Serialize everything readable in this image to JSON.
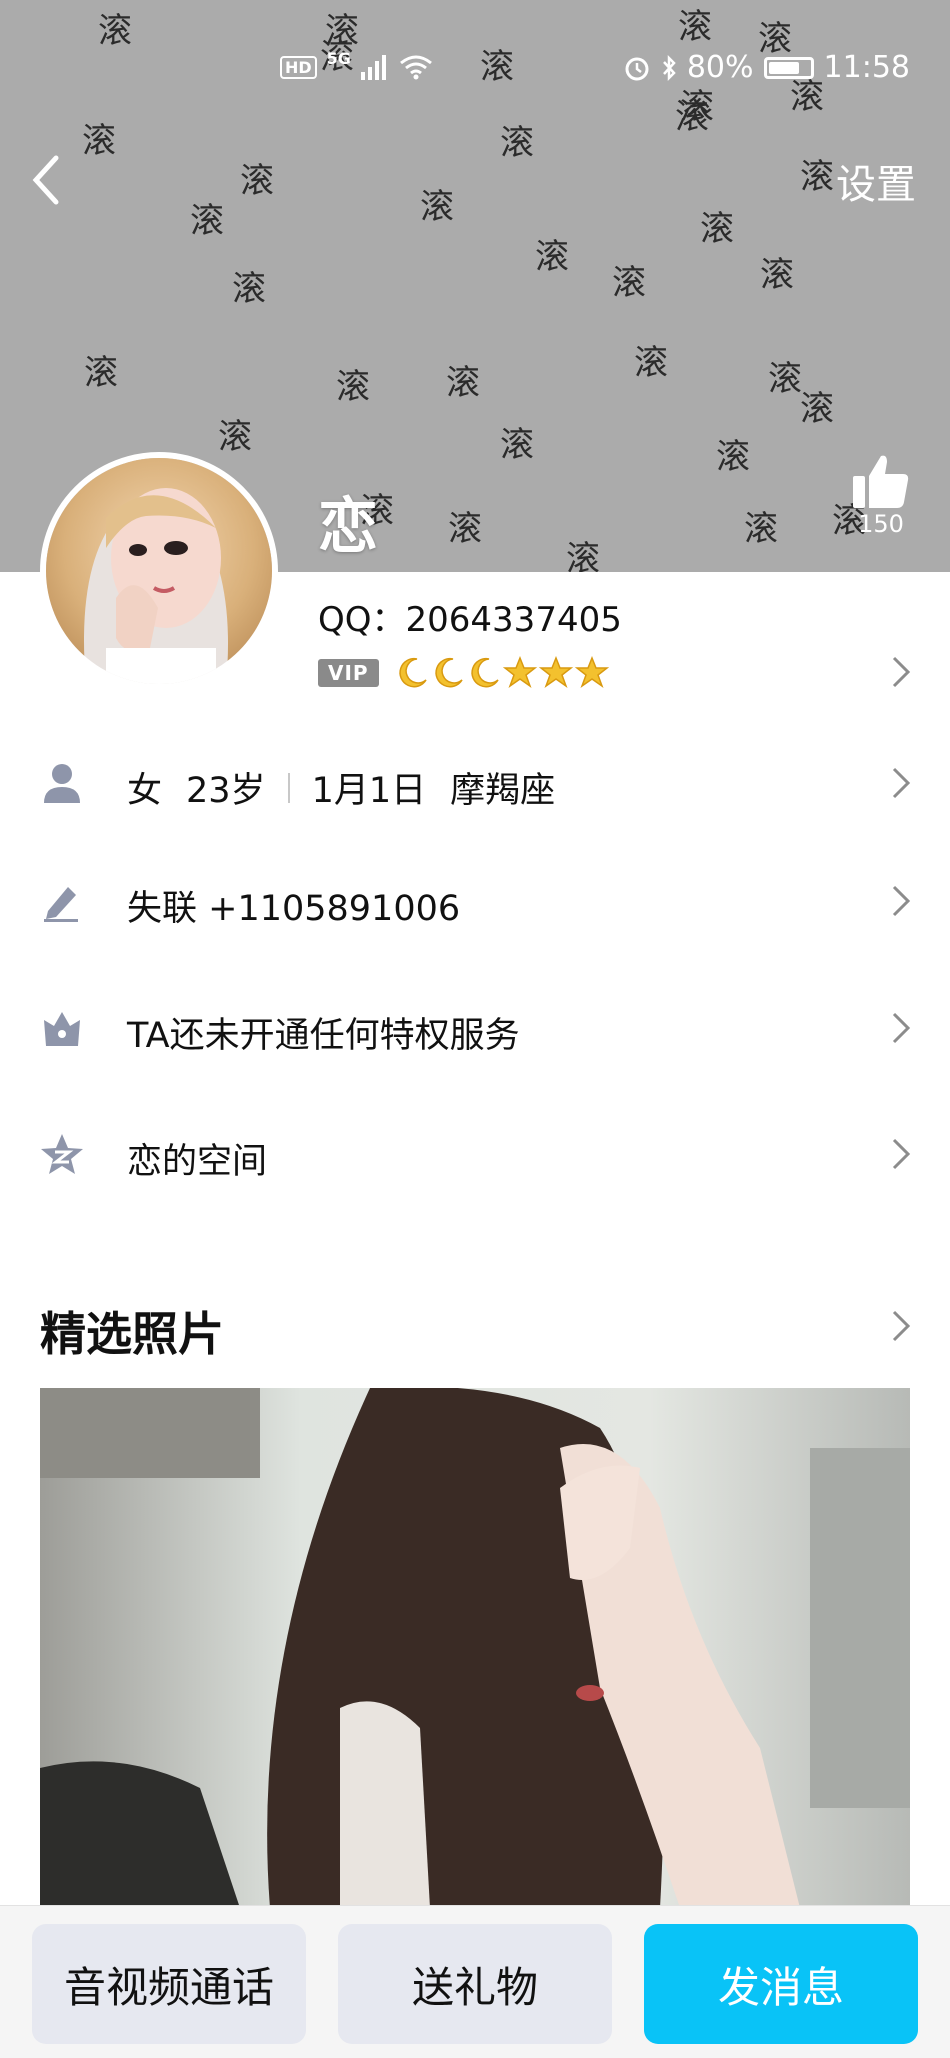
{
  "status_bar": {
    "network": "5G",
    "hd": "HD",
    "battery_percent": "80%",
    "time": "11:58"
  },
  "header": {
    "settings_label": "设置",
    "like_count": "150",
    "nickname": "恋",
    "cover_pattern_char": "滚"
  },
  "profile": {
    "qq_id": "QQ：2064337405",
    "vip_label": "VIP",
    "level_icons": [
      "moon-icon",
      "moon-icon",
      "moon-icon",
      "star-icon",
      "star-icon",
      "star-icon"
    ]
  },
  "info_rows": {
    "gender": "女",
    "age": "23岁",
    "birthday": "1月1日",
    "zodiac": "摩羯座",
    "signature": "失联 +1105891006",
    "privileges": "TA还未开通任何特权服务",
    "qzone": "恋的空间"
  },
  "photos_section": {
    "title": "精选照片"
  },
  "bottom_bar": {
    "call_label": "音视频通话",
    "gift_label": "送礼物",
    "message_label": "发消息"
  },
  "colors": {
    "cover_bg": "#ababab",
    "primary_button": "#09c3f7",
    "secondary_button": "#e6e8f0",
    "icon_gray": "#8e95aa"
  }
}
